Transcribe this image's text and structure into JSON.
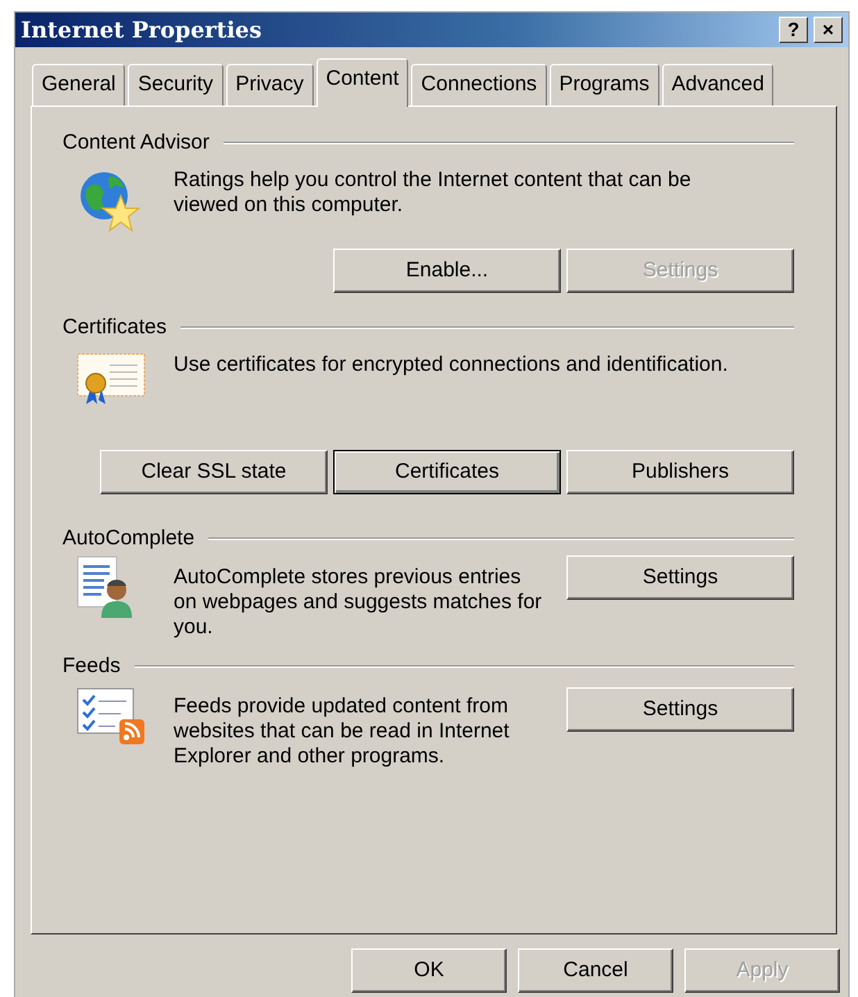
{
  "window": {
    "title": "Internet Properties",
    "controls": [
      "?",
      "×"
    ]
  },
  "tabs": [
    {
      "label": "General",
      "selected": false
    },
    {
      "label": "Security",
      "selected": false
    },
    {
      "label": "Privacy",
      "selected": false
    },
    {
      "label": "Content",
      "selected": true
    },
    {
      "label": "Connections",
      "selected": false
    },
    {
      "label": "Programs",
      "selected": false
    },
    {
      "label": "Advanced",
      "selected": false
    }
  ],
  "sections": [
    {
      "title": "Content Advisor",
      "kind": "stacked",
      "description": "Ratings help you control the Internet content that can be viewed on this computer.",
      "buttons": [
        {
          "label": "Enable...",
          "disabled": false,
          "default": false
        },
        {
          "label": "Settings",
          "disabled": true,
          "default": false
        }
      ]
    },
    {
      "title": "Certificates",
      "kind": "stacked",
      "description": "Use certificates for encrypted connections and identification.",
      "buttons": [
        {
          "label": "Clear SSL state",
          "disabled": false,
          "default": false
        },
        {
          "label": "Certificates",
          "disabled": false,
          "default": true
        },
        {
          "label": "Publishers",
          "disabled": false,
          "default": false
        }
      ]
    },
    {
      "title": "AutoComplete",
      "kind": "side",
      "description": "AutoComplete stores previous entries on webpages and suggests matches for you.",
      "buttons": [
        {
          "label": "Settings",
          "disabled": false,
          "default": false
        }
      ]
    },
    {
      "title": "Feeds",
      "kind": "side",
      "description": "Feeds provide updated content from websites that can be read in Internet Explorer and other programs.",
      "buttons": [
        {
          "label": "Settings",
          "disabled": false,
          "default": false
        }
      ]
    }
  ],
  "footer_buttons": [
    {
      "label": "OK",
      "disabled": false
    },
    {
      "label": "Cancel",
      "disabled": false
    },
    {
      "label": "Apply",
      "disabled": true
    }
  ]
}
